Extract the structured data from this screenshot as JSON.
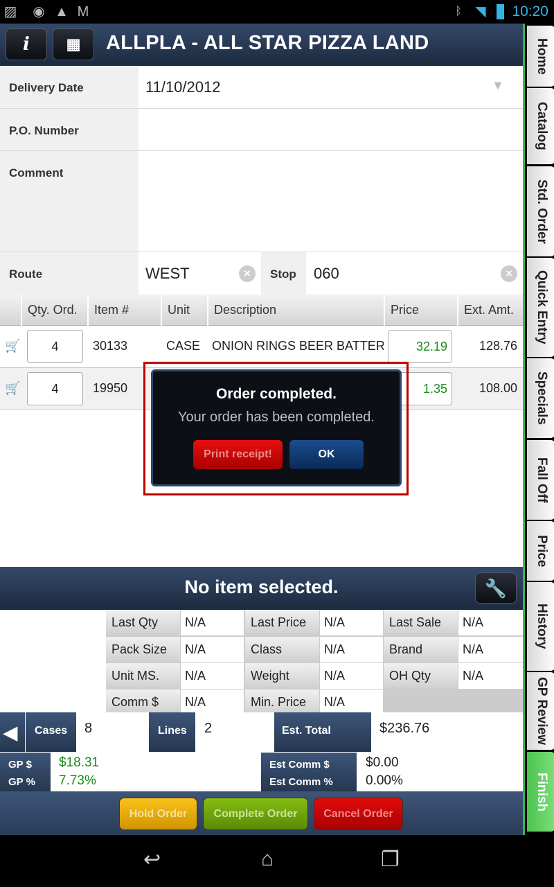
{
  "status_bar": {
    "icons": [
      "image-icon",
      "chrome-icon",
      "warning-icon",
      "gmail-icon",
      "bluetooth-icon",
      "wifi-icon",
      "battery-icon"
    ],
    "time": "10:20"
  },
  "header": {
    "title": "ALLPLA - ALL STAR PIZZA LAND",
    "info_icon": "info-icon",
    "calculator_icon": "calculator-icon"
  },
  "side_tabs": [
    "Home",
    "Catalog",
    "Std. Order",
    "Quick Entry",
    "Specials",
    "Fall Off",
    "Price",
    "History",
    "GP Review",
    "Finish"
  ],
  "form": {
    "delivery_date_label": "Delivery Date",
    "delivery_date": "11/10/2012",
    "po_label": "P.O. Number",
    "po": "",
    "comment_label": "Comment",
    "comment": "",
    "route_label": "Route",
    "route": "WEST",
    "stop_label": "Stop",
    "stop": "060"
  },
  "table": {
    "headers": [
      "Qty. Ord.",
      "Item #",
      "Unit",
      "Description",
      "Price",
      "Ext. Amt."
    ],
    "rows": [
      {
        "qty": "4",
        "item": "30133",
        "unit": "CASE",
        "description": "ONION RINGS BEER BATTERE",
        "price": "32.19",
        "ext": "128.76"
      },
      {
        "qty": "4",
        "item": "19950",
        "price": "1.35",
        "ext": "108.00"
      }
    ]
  },
  "dialog": {
    "title": "Order completed.",
    "message": "Your order has been completed.",
    "print_label": "Print receipt!",
    "ok_label": "OK"
  },
  "item_panel": {
    "title": "No item selected.",
    "fields": [
      {
        "label": "Last Qty",
        "value": "N/A"
      },
      {
        "label": "Last Price",
        "value": "N/A"
      },
      {
        "label": "Last Sale",
        "value": "N/A"
      },
      {
        "label": "Pack Size",
        "value": "N/A"
      },
      {
        "label": "Class",
        "value": "N/A"
      },
      {
        "label": "Brand",
        "value": "N/A"
      },
      {
        "label": "Unit MS.",
        "value": "N/A"
      },
      {
        "label": "Weight",
        "value": "N/A"
      },
      {
        "label": "OH Qty",
        "value": "N/A"
      },
      {
        "label": "Comm $",
        "value": "N/A"
      },
      {
        "label": "Min. Price",
        "value": "N/A"
      }
    ]
  },
  "summary": {
    "cases_label": "Cases",
    "cases": "8",
    "lines_label": "Lines",
    "lines": "2",
    "est_total_label": "Est. Total",
    "est_total": "$236.76",
    "gp_dollar_label": "GP $",
    "gp_dollar": "$18.31",
    "gp_pct_label": "GP %",
    "gp_pct": "7.73%",
    "est_comm_dollar_label": "Est Comm $",
    "est_comm_dollar": "$0.00",
    "est_comm_pct_label": "Est Comm %",
    "est_comm_pct": "0.00%"
  },
  "actions": {
    "hold": "Hold Order",
    "complete": "Complete Order",
    "cancel": "Cancel Order"
  },
  "colors": {
    "accent_green": "#3fb34a",
    "header_navy": "#1c2a3e",
    "hold": "#f0b414",
    "complete": "#6ea812",
    "cancel": "#d40808",
    "dialog_highlight": "#c00000"
  }
}
